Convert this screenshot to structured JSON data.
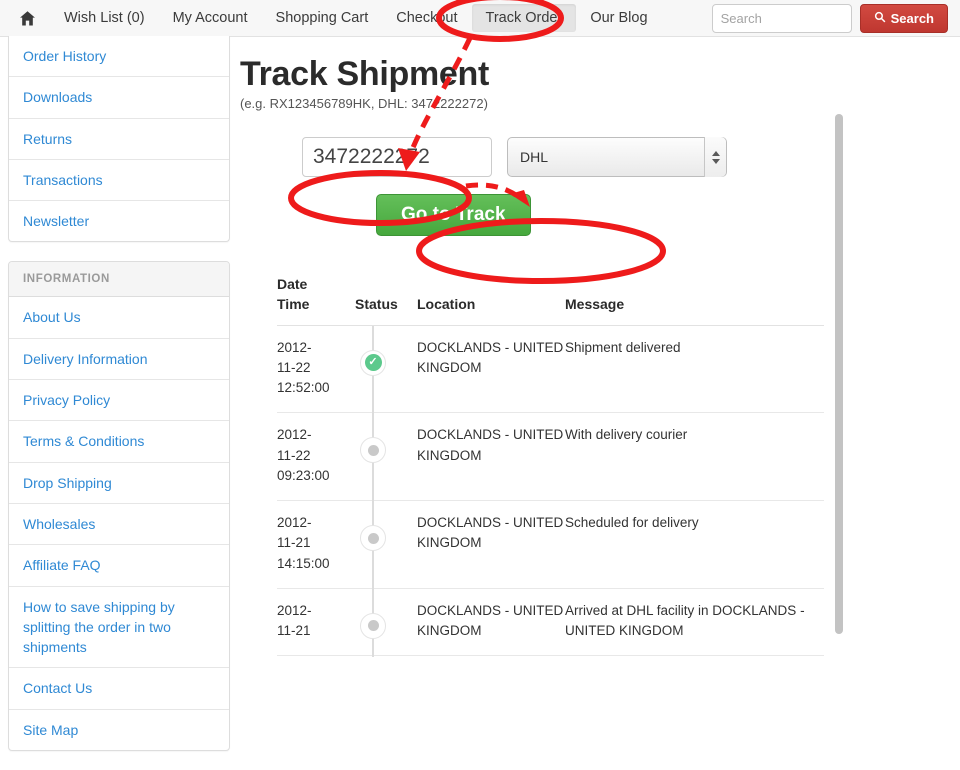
{
  "topnav": {
    "home_icon": "home-icon",
    "items": [
      {
        "label": "Wish List (0)",
        "active": false
      },
      {
        "label": "My Account",
        "active": false
      },
      {
        "label": "Shopping Cart",
        "active": false
      },
      {
        "label": "Checkout",
        "active": false
      },
      {
        "label": "Track Order",
        "active": true
      },
      {
        "label": "Our Blog",
        "active": false
      }
    ],
    "search_placeholder": "Search",
    "search_value": "",
    "search_button_label": "Search",
    "search_icon": "magnifier-icon"
  },
  "sidebar": {
    "account_links": [
      "Order History",
      "Downloads",
      "Returns",
      "Transactions",
      "Newsletter"
    ],
    "information_header": "INFORMATION",
    "information_links": [
      "About Us",
      "Delivery Information",
      "Privacy Policy",
      "Terms & Conditions",
      "Drop Shipping",
      "Wholesales",
      "Affiliate FAQ",
      "How to save shipping by splitting the order in two shipments",
      "Contact Us",
      "Site Map"
    ]
  },
  "main": {
    "title": "Track Shipment",
    "hint": "(e.g. RX123456789HK, DHL: 3472222272)",
    "tracking_number_value": "3472222272",
    "tracking_number_placeholder": "",
    "carrier_selected": "DHL",
    "submit_label": "Go to Track"
  },
  "table": {
    "headers": [
      "Date Time",
      "Status",
      "Location",
      "Message"
    ],
    "header_date_line1": "Date",
    "header_date_line2": "Time",
    "rows": [
      {
        "date": "2012-",
        "date2": "11-22",
        "time": "12:52:00",
        "status": "delivered",
        "status_icon": "check-circle-icon",
        "location": "DOCKLANDS - UNITED KINGDOM",
        "message": "Shipment delivered"
      },
      {
        "date": "2012-",
        "date2": "11-22",
        "time": "09:23:00",
        "status": "past",
        "status_icon": "dot-icon",
        "location": "DOCKLANDS - UNITED KINGDOM",
        "message": "With delivery courier"
      },
      {
        "date": "2012-",
        "date2": "11-21",
        "time": "14:15:00",
        "status": "past",
        "status_icon": "dot-icon",
        "location": "DOCKLANDS - UNITED KINGDOM",
        "message": "Scheduled for delivery"
      },
      {
        "date": "2012-",
        "date2": "11-21",
        "time": "",
        "status": "past",
        "status_icon": "dot-icon",
        "location": "DOCKLANDS - UNITED KINGDOM",
        "message": "Arrived at DHL facility in DOCKLANDS - UNITED KINGDOM"
      }
    ]
  },
  "colors": {
    "link": "#2f89d4",
    "search_button": "#bf3730",
    "go_button": "#4fb045",
    "annotation": "#ee1b1b",
    "status_ok": "#5cc98c"
  }
}
